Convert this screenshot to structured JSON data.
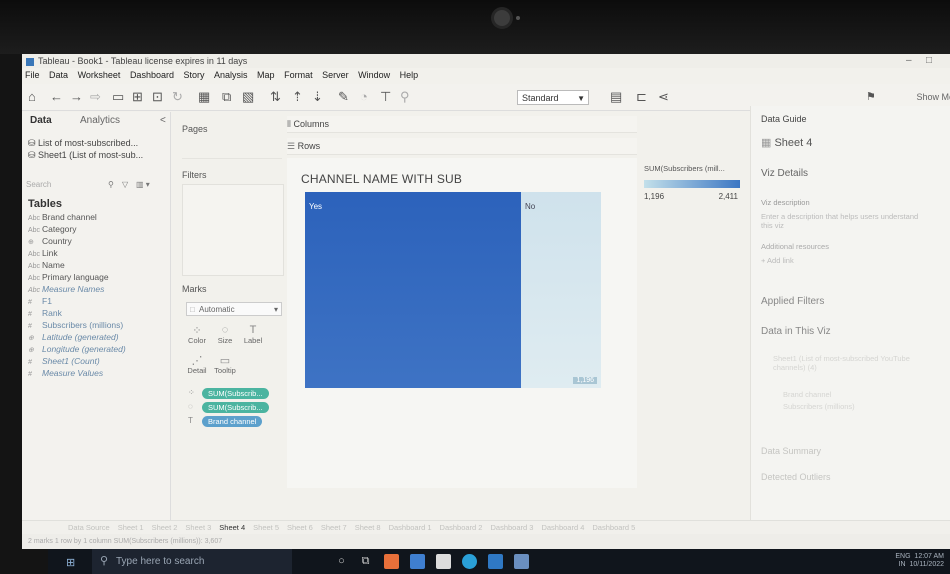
{
  "window": {
    "title": "Tableau - Book1 - Tableau license expires in 11 days",
    "min": "–",
    "max": "□"
  },
  "menu": [
    "File",
    "Data",
    "Worksheet",
    "Dashboard",
    "Story",
    "Analysis",
    "Map",
    "Format",
    "Server",
    "Window",
    "Help"
  ],
  "toolbar": {
    "fit_select": "Standard",
    "show_me": "Show Me"
  },
  "left_panel": {
    "tab_data": "Data",
    "tab_analytics": "Analytics",
    "collapse": "<",
    "sources": [
      "List of most-subscribed...",
      "Sheet1 (List of most-sub..."
    ],
    "search_placeholder": "Search",
    "tables_heading": "Tables",
    "fields": [
      {
        "icon": "Abc",
        "name": "Brand channel"
      },
      {
        "icon": "Abc",
        "name": "Category"
      },
      {
        "icon": "⊕",
        "name": "Country"
      },
      {
        "icon": "Abc",
        "name": "Link"
      },
      {
        "icon": "Abc",
        "name": "Name"
      },
      {
        "icon": "Abc",
        "name": "Primary language"
      },
      {
        "icon": "Abc",
        "name": "Measure Names"
      },
      {
        "icon": "#",
        "name": "F1"
      },
      {
        "icon": "#",
        "name": "Rank"
      },
      {
        "icon": "#",
        "name": "Subscribers (millions)"
      },
      {
        "icon": "⊕",
        "name": "Latitude (generated)"
      },
      {
        "icon": "⊕",
        "name": "Longitude (generated)"
      },
      {
        "icon": "#",
        "name": "Sheet1 (Count)"
      },
      {
        "icon": "#",
        "name": "Measure Values"
      }
    ]
  },
  "cards": {
    "pages": "Pages",
    "filters": "Filters",
    "marks": "Marks",
    "mark_type": "Automatic",
    "mark_buttons": [
      {
        "glyph": "⁘",
        "label": "Color"
      },
      {
        "glyph": "◌",
        "label": "Size"
      },
      {
        "glyph": "T",
        "label": "Label"
      },
      {
        "glyph": "⋰",
        "label": "Detail"
      },
      {
        "glyph": "▭",
        "label": "Tooltip"
      }
    ],
    "pills": [
      {
        "icon": "⁘",
        "text": "SUM(Subscrib..."
      },
      {
        "icon": "◌",
        "text": "SUM(Subscrib..."
      },
      {
        "icon": "T",
        "text": "Brand channel"
      }
    ]
  },
  "shelves": {
    "columns": "Columns",
    "rows": "Rows"
  },
  "viz": {
    "title": "CHANNEL NAME WITH SUB",
    "tiles": [
      {
        "label": "Yes",
        "value": 2411
      },
      {
        "label": "No",
        "value": 1196
      }
    ],
    "small_badge": "1,196"
  },
  "legend": {
    "title": "SUM(Subscribers (mill...",
    "min": "1,196",
    "max": "2,411"
  },
  "data_guide": {
    "heading": "Data Guide",
    "sheet": "Sheet 4",
    "viz_details": "Viz Details",
    "viz_description": "Viz description",
    "desc_placeholder": "Enter a description that helps users understand this viz",
    "additional_resources": "Additional resources",
    "add_link": "+ Add link",
    "applied_filters": "Applied Filters",
    "data_in_viz": "Data in This Viz",
    "source_item": "Sheet1 (List of most-subscribed YouTube channels) (4)",
    "field1": "Brand channel",
    "field2": "Subscribers (millions)",
    "data_summary": "Data Summary",
    "detected_outliers": "Detected Outliers"
  },
  "sheet_tabs": [
    "Data Source",
    "Sheet 1",
    "Sheet 2",
    "Sheet 3",
    "Sheet 4",
    "Sheet 5",
    "Sheet 6",
    "Sheet 7",
    "Sheet 8",
    "Dashboard 1",
    "Dashboard 2",
    "Dashboard 3",
    "Dashboard 4",
    "Dashboard 5"
  ],
  "active_sheet": "Sheet 4",
  "status": "2 marks    1 row by 1 column    SUM(Subscribers (millions)): 3,607",
  "taskbar": {
    "search_placeholder": "Type here to search",
    "lang": "ENG",
    "region": "IN",
    "time": "12:07 AM",
    "date": "10/11/2022"
  },
  "colors": {
    "tile_yes": "#2c62bb",
    "tile_no": "#d6e7ef",
    "pill_green": "#4bb4a0",
    "pill_blue": "#5ca0cc"
  }
}
